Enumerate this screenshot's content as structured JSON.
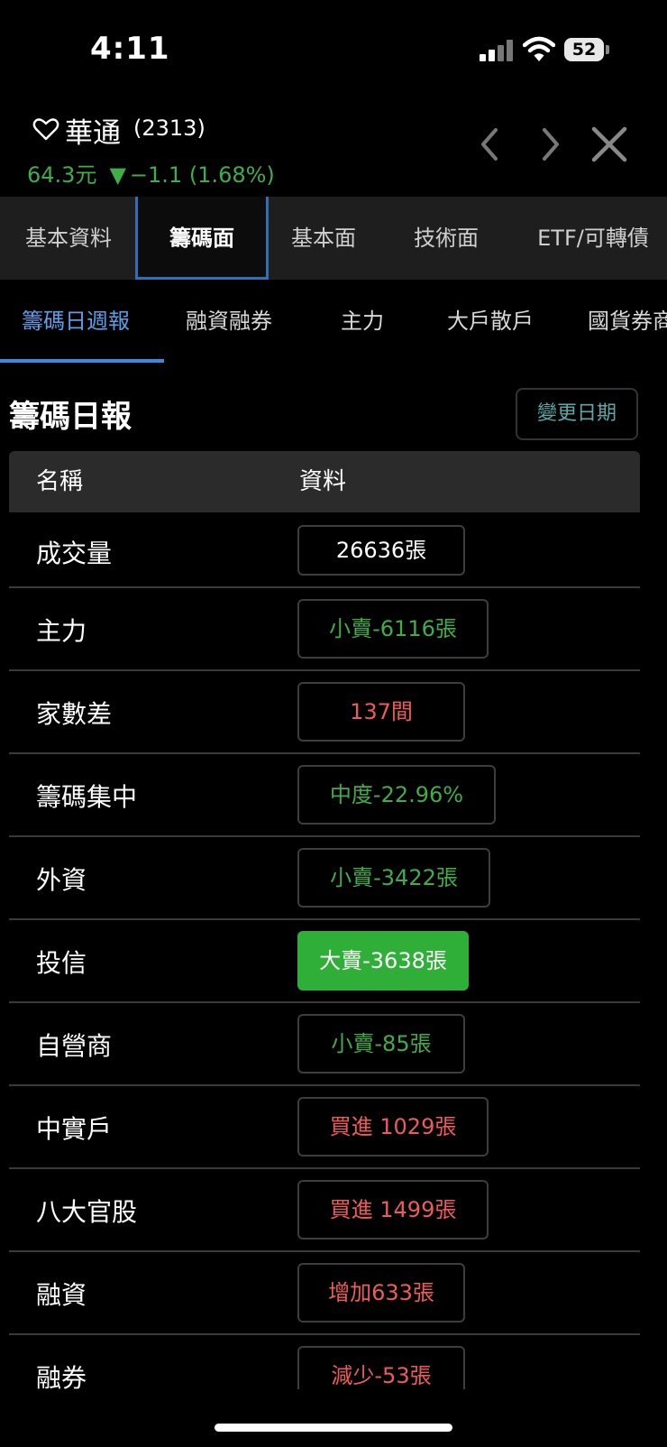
{
  "status_bar": {
    "time": "4:11",
    "battery": "52"
  },
  "stock": {
    "name": "華通",
    "code": "(2313)",
    "price": "64.3元",
    "change": "−1.1 (1.68%)"
  },
  "main_tabs": [
    "基本資料",
    "籌碼面",
    "基本面",
    "技術面",
    "ETF/可轉債"
  ],
  "sub_tabs": [
    "籌碼日週報",
    "融資融券",
    "主力",
    "大戶散戶",
    "國貨券商"
  ],
  "section": {
    "title": "籌碼日報",
    "change_date": "變更日期"
  },
  "table": {
    "headers": [
      "名稱",
      "資料"
    ],
    "rows": [
      {
        "label": "成交量",
        "value": "26636張"
      },
      {
        "label": "主力",
        "value": "小賣-6116張"
      },
      {
        "label": "家數差",
        "value": "137間"
      },
      {
        "label": "籌碼集中",
        "value": "中度-22.96%"
      },
      {
        "label": "外資",
        "value": "小賣-3422張"
      },
      {
        "label": "投信",
        "value": "大賣-3638張"
      },
      {
        "label": "自營商",
        "value": "小賣-85張"
      },
      {
        "label": "中實戶",
        "value": "買進 1029張"
      },
      {
        "label": "八大官股",
        "value": "買進 1499張"
      },
      {
        "label": "融資",
        "value": "增加633張"
      },
      {
        "label": "融券",
        "value": "減少-53張"
      }
    ]
  },
  "colors": {
    "down": "#3fae49",
    "up": "#ef5a5a",
    "accent": "#3a8ae0"
  }
}
